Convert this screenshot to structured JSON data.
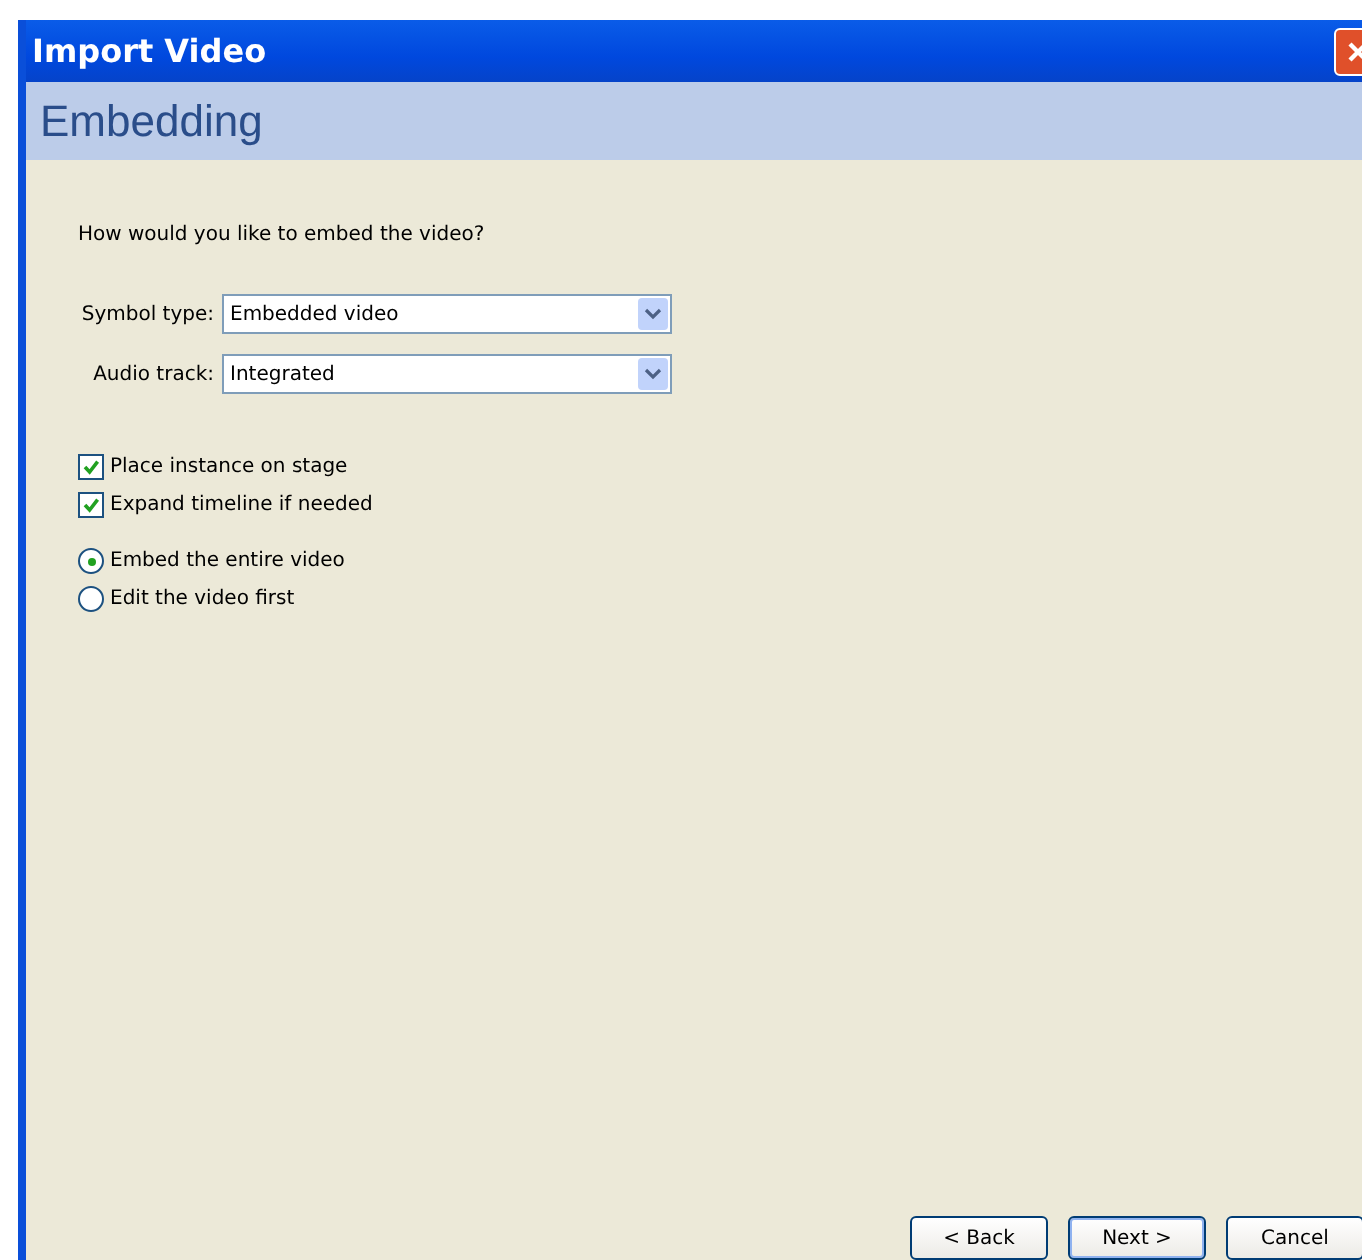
{
  "window": {
    "title": "Import Video"
  },
  "header": {
    "title": "Embedding"
  },
  "question": "How would you like to embed the video?",
  "fields": [
    {
      "label": "Symbol type:",
      "value": "Embedded video"
    },
    {
      "label": "Audio track:",
      "value": "Integrated"
    }
  ],
  "checkboxes": [
    {
      "label": "Place instance on stage",
      "checked": true
    },
    {
      "label": "Expand timeline if needed",
      "checked": true
    }
  ],
  "radios": [
    {
      "label": "Embed the entire video",
      "selected": true
    },
    {
      "label": "Edit the video first",
      "selected": false
    }
  ],
  "buttons": [
    {
      "label": "< Back",
      "kind": "normal"
    },
    {
      "label": "Next >",
      "kind": "default"
    },
    {
      "label": "Cancel",
      "kind": "normal"
    }
  ]
}
